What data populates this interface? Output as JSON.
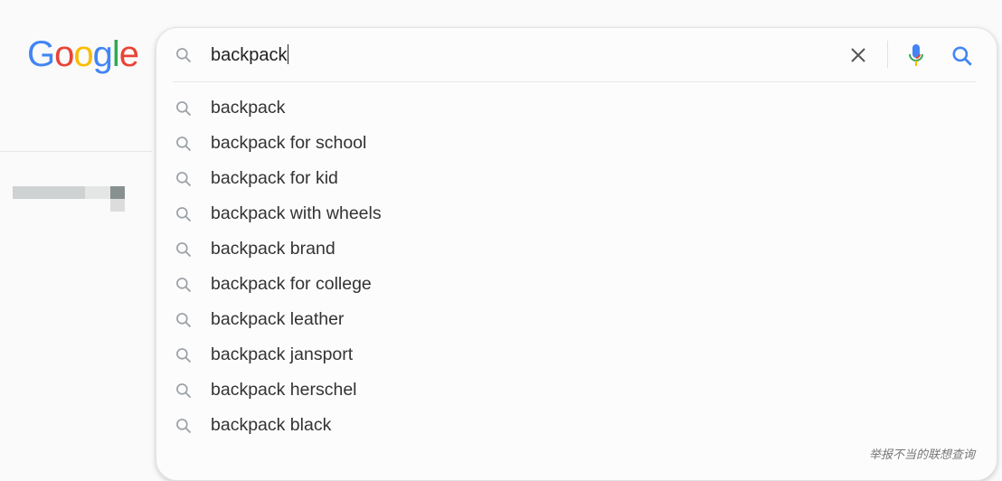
{
  "logo": {
    "letters": [
      "G",
      "o",
      "o",
      "g",
      "l",
      "e"
    ],
    "colors": [
      "#4285F4",
      "#EA4335",
      "#FBBC05",
      "#4285F4",
      "#34A853",
      "#EA4335"
    ]
  },
  "search": {
    "value": "backpack"
  },
  "suggestions": [
    "backpack",
    "backpack for school",
    "backpack for kid",
    "backpack with wheels",
    "backpack brand",
    "backpack for college",
    "backpack leather",
    "backpack jansport",
    "backpack herschel",
    "backpack black"
  ],
  "footer": {
    "report_link": "举报不当的联想查询"
  },
  "icons": {
    "search": "search-icon",
    "clear": "close-icon",
    "voice": "microphone-icon"
  }
}
